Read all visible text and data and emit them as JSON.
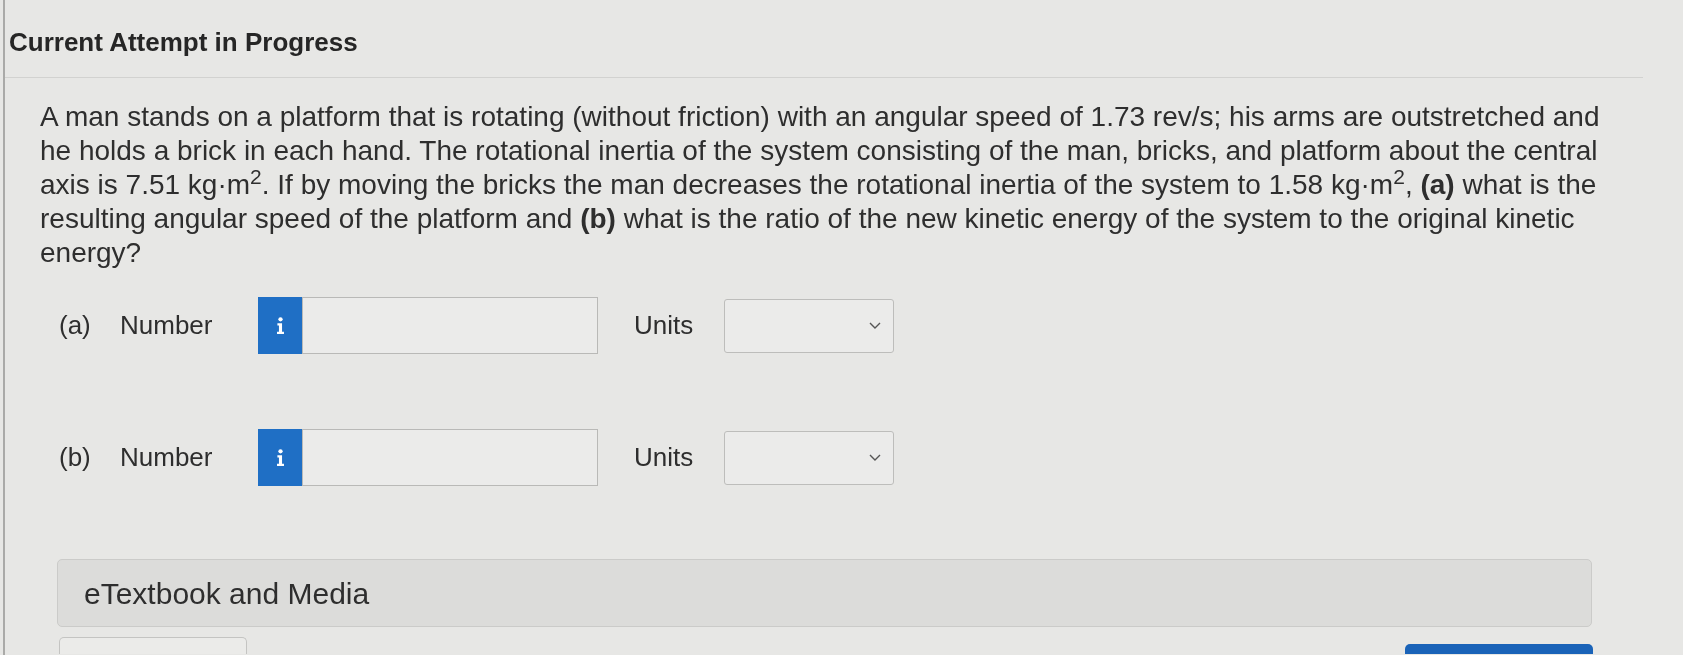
{
  "header": {
    "title": "Current Attempt in Progress"
  },
  "question": {
    "text": "A man stands on a platform that is rotating (without friction) with an angular speed of 1.73 rev/s; his arms are outstretched and he holds a brick in each hand. The rotational inertia of the system consisting of the man, bricks, and platform about the central axis is 7.51 kg·m$^{2}$. If by moving the bricks the man decreases the rotational inertia of the system to 1.58 kg·m$^{2}$, **(a)** what is the resulting angular speed of the platform and **(b)** what is the ratio of the new kinetic energy of the system to the original kinetic energy?"
  },
  "answers": [
    {
      "part": "(a)",
      "label": "Number",
      "units_label": "Units"
    },
    {
      "part": "(b)",
      "label": "Number",
      "units_label": "Units"
    }
  ],
  "resources": {
    "title": "eTextbook and Media"
  }
}
